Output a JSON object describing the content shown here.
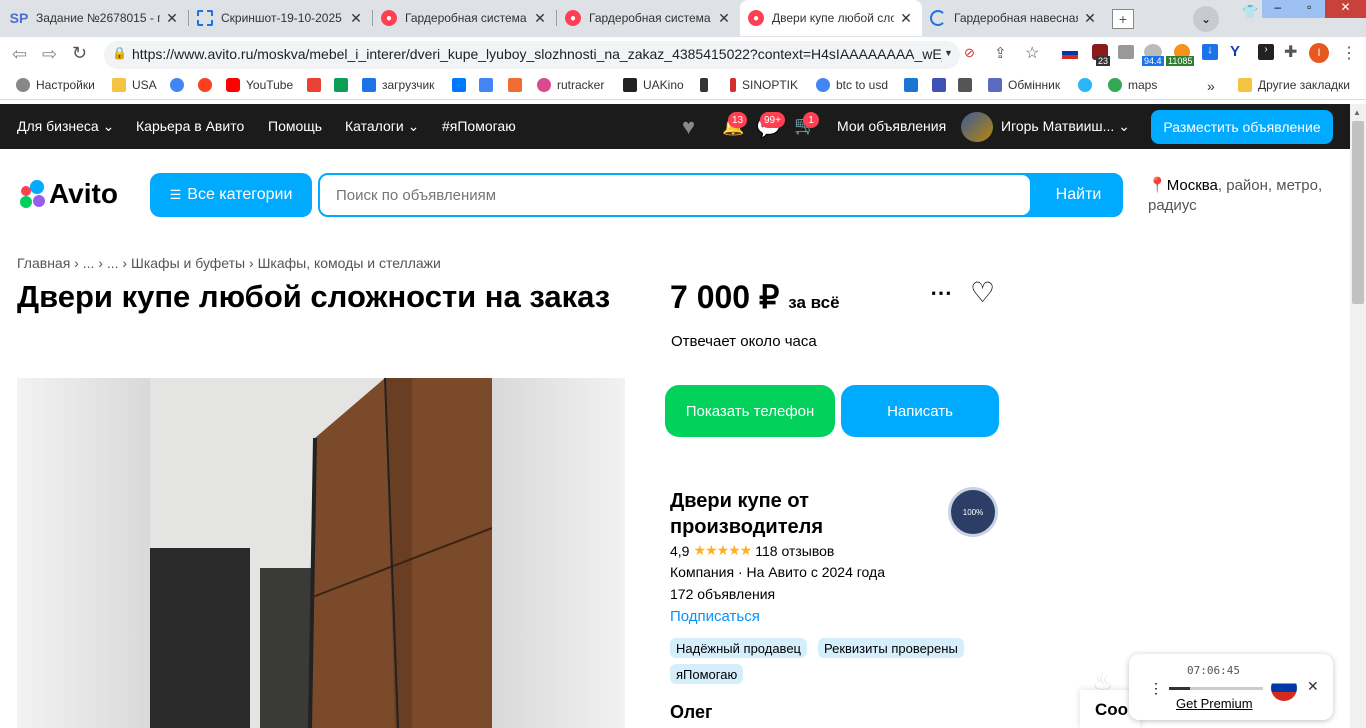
{
  "browser": {
    "tabs": [
      {
        "title": "Задание №2678015 - п",
        "favicon": "SP"
      },
      {
        "title": "Скриншот-19-10-2025 ",
        "favicon": "screenshot-icon"
      },
      {
        "title": "Гардеробная система -",
        "favicon": "avito-icon"
      },
      {
        "title": "Гардеробная система к",
        "favicon": "avito-icon"
      },
      {
        "title": "Двери купе любой сло",
        "favicon": "avito-icon"
      },
      {
        "title": "Гардеробная навесная",
        "favicon": "loading-icon"
      }
    ],
    "url": "https://www.avito.ru/moskva/mebel_i_interer/dveri_kupe_lyuboy_slozhnosti_na_zakaz_4385415022?context=H4sIAAAAAAAA_wE_...",
    "ext_badges": {
      "b1": "23",
      "b2": "94.4",
      "b3": "11085"
    },
    "bookmarks": [
      "Настройки",
      "USA",
      "",
      "",
      "YouTube",
      "",
      "",
      "загрузчик",
      "",
      "",
      "",
      "rutracker",
      "UAKino",
      "",
      "SINOPTIK",
      "btc to usd",
      "",
      "",
      "",
      "Обмінник",
      "",
      "maps"
    ],
    "bookmarks_more": "»",
    "other_bookmarks": "Другие закладки"
  },
  "topnav": {
    "items": [
      "Для бизнеса",
      "Карьера в Авито",
      "Помощь",
      "Каталоги",
      "#яПомогаю"
    ],
    "badges": [
      "13",
      "99+",
      "1"
    ],
    "my_ads": "Мои объявления",
    "user": "Игорь Матвииш...",
    "post_button": "Разместить объявление"
  },
  "header": {
    "logo": "Avito",
    "all_categories": "Все категории",
    "search_placeholder": "Поиск по объявлениям",
    "search_button": "Найти",
    "location_main": "Москва",
    "location_rest": ", район, метро, радиус"
  },
  "listing": {
    "breadcrumbs": [
      "Главная",
      "...",
      "...",
      "Шкафы и буфеты",
      "Шкафы, комоды и стеллажи"
    ],
    "title": "Двери купе любой сложности на заказ",
    "price": "7 000 ₽",
    "price_suffix": "за всё",
    "response_time": "Отвечает около часа",
    "show_phone": "Показать телефон",
    "write": "Написать"
  },
  "seller": {
    "name": "Двери купе от производителя",
    "rating": "4,9",
    "stars": 5,
    "reviews": "118 отзывов",
    "type_since": "Компания · На Авито с 2024 года",
    "ads": "172 объявления",
    "subscribe": "Подписаться",
    "tags": [
      "Надёжный продавец",
      "Реквизиты проверены",
      "яПомогаю"
    ],
    "contact_name": "Олег",
    "badge_text": "100%"
  },
  "widget": {
    "time": "07:06:45",
    "get_premium": "Get Premium",
    "partial_text": "Соо"
  },
  "colors": {
    "accent": "#00aaff",
    "green": "#02d15c",
    "nav": "#1b1b1b",
    "badge": "#ff4053"
  }
}
